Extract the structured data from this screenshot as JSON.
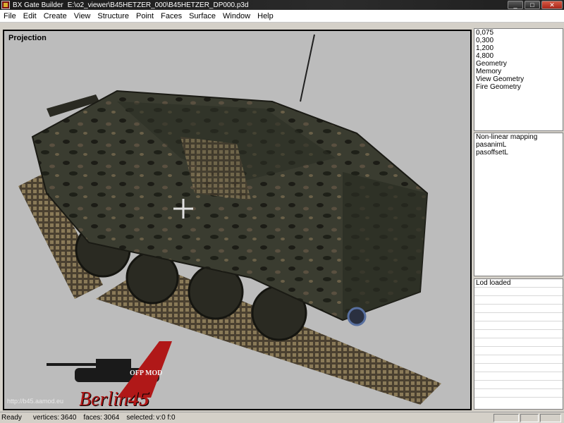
{
  "window": {
    "app_name": "BX Gate Builder",
    "file_path": "E:\\o2_viewer\\B45HETZER_000\\B45HETZER_DP000.p3d",
    "buttons": {
      "minimize": "_",
      "maximize": "□",
      "close": "✕"
    }
  },
  "menu": [
    "File",
    "Edit",
    "Create",
    "View",
    "Structure",
    "Point",
    "Faces",
    "Surface",
    "Window",
    "Help"
  ],
  "viewport": {
    "label": "Projection",
    "watermark_url": "http://b45.aamod.eu",
    "logo_text_ofp": "OFP MOD",
    "logo_text_berlin": "Berlin",
    "logo_text_45": "45"
  },
  "lod_list": [
    "0,075",
    "0,300",
    "1,200",
    "4,800",
    "Geometry",
    "Memory",
    "View Geometry",
    "Fire Geometry"
  ],
  "properties": [
    "Non-linear mapping",
    "pasanimL",
    "pasoffsetL"
  ],
  "log": [
    "Lod loaded"
  ],
  "status": {
    "ready": "Ready",
    "vertices_label": "vertices:",
    "vertices": "3640",
    "faces_label": "faces:",
    "faces": "3064",
    "selected_label": "selected:",
    "selected": "v:0 f:0"
  },
  "colors": {
    "viewport_bg": "#bcbcbc",
    "hull": "#3a3c30",
    "track": "#6a5c40",
    "logo_red": "#b01818"
  }
}
